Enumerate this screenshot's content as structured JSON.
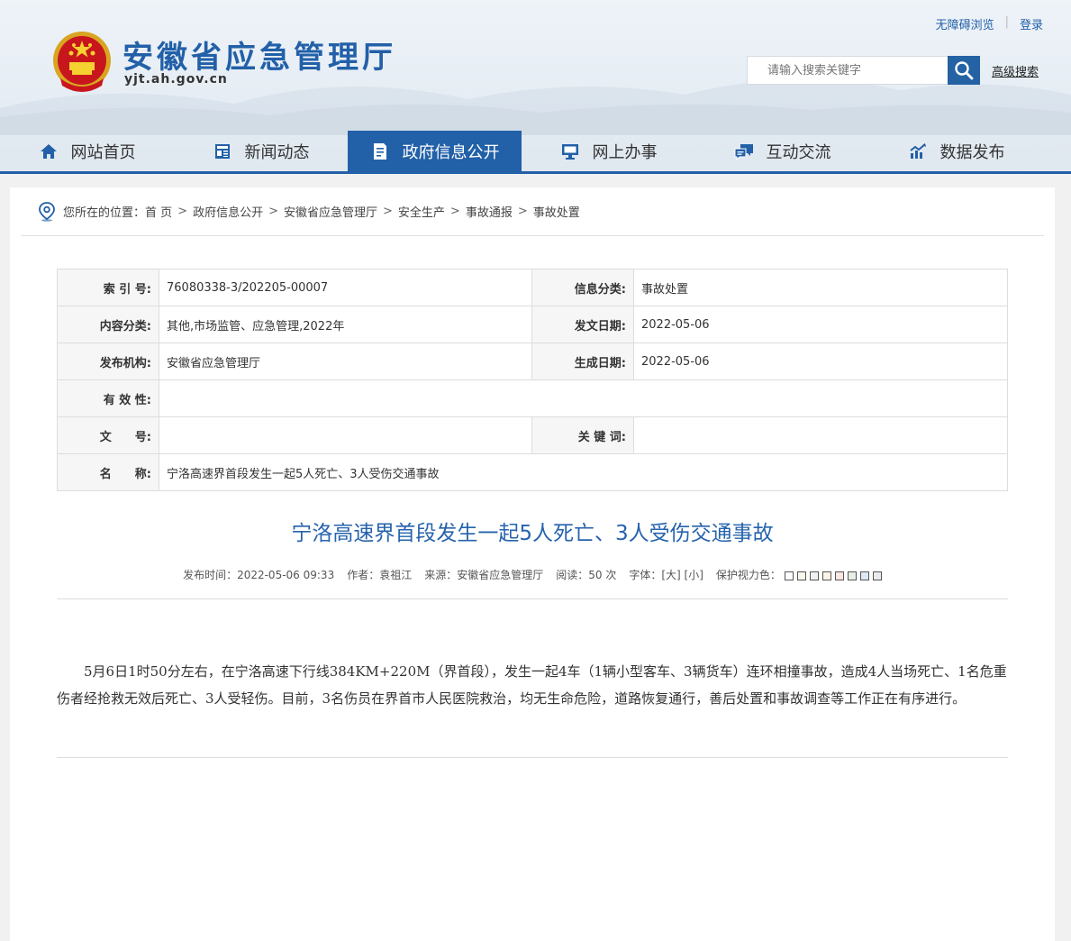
{
  "header": {
    "site_title": "安徽省应急管理厅",
    "site_domain": "yjt.ah.gov.cn",
    "accessible_link": "无障碍浏览",
    "login_link": "登录",
    "search_placeholder": "请输入搜索关键字",
    "advanced_search": "高级搜索"
  },
  "nav": {
    "items": [
      {
        "label": "网站首页",
        "icon": "home-icon"
      },
      {
        "label": "新闻动态",
        "icon": "news-icon"
      },
      {
        "label": "政府信息公开",
        "icon": "document-icon"
      },
      {
        "label": "网上办事",
        "icon": "monitor-icon"
      },
      {
        "label": "互动交流",
        "icon": "chat-icon"
      },
      {
        "label": "数据发布",
        "icon": "chart-icon"
      }
    ],
    "active_color": "#2260a8"
  },
  "breadcrumb": {
    "prefix": "您所在的位置：",
    "items": [
      "首 页",
      "政府信息公开",
      "安徽省应急管理厅",
      "安全生产",
      "事故通报",
      "事故处置"
    ]
  },
  "meta": {
    "index_label": "索 引 号:",
    "index_value": "76080338-3/202205-00007",
    "category_label": "信息分类:",
    "category_value": "事故处置",
    "content_label": "内容分类:",
    "content_value": "其他,市场监管、应急管理,2022年",
    "issue_date_label": "发文日期:",
    "issue_date_value": "2022-05-06",
    "org_label": "发布机构:",
    "org_value": "安徽省应急管理厅",
    "gen_date_label": "生成日期:",
    "gen_date_value": "2022-05-06",
    "validity_label": "有 效 性:",
    "validity_value": "",
    "docno_label": "文　　号:",
    "docno_value": "",
    "keywords_label": "关 键 词:",
    "keywords_value": "",
    "name_label": "名　　称:",
    "name_value": "宁洛高速界首段发生一起5人死亡、3人受伤交通事故"
  },
  "article": {
    "title": "宁洛高速界首段发生一起5人死亡、3人受伤交通事故",
    "publish_time": "发布时间：2022-05-06 09:33",
    "author": "作者：袁祖江",
    "source": "来源：安徽省应急管理厅",
    "reads": "阅读：50 次",
    "font_label": "字体：",
    "font_large": "[大]",
    "font_small": "[小]",
    "eye_care_label": "保护视力色：",
    "eye_care_colors": [
      "#ffffff",
      "#faf6e9",
      "#f2f2f2",
      "#fef3e6",
      "#fde6e0",
      "#e6f0e2",
      "#dce9f5",
      "#eaeaef"
    ],
    "body": "5月6日1时50分左右，在宁洛高速下行线384KM+220M（界首段），发生一起4车（1辆小型客车、3辆货车）连环相撞事故，造成4人当场死亡、1名危重伤者经抢救无效后死亡、3人受轻伤。目前，3名伤员在界首市人民医院救治，均无生命危险，道路恢复通行，善后处置和事故调查等工作正在有序进行。"
  }
}
